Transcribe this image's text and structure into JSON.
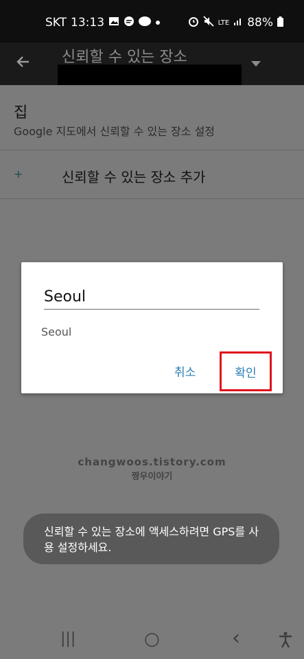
{
  "status_bar": {
    "carrier": "SKT",
    "time": "13:13",
    "network": "LTE",
    "battery": "88%",
    "icons": [
      "gallery-icon",
      "message-icon",
      "talk-icon",
      "dot-icon",
      "alarm-icon",
      "mute-icon",
      "signal-icon",
      "battery-icon"
    ]
  },
  "toolbar": {
    "back_icon": "back-arrow-icon",
    "title": "신뢰할 수 있는 장소",
    "dropdown_icon": "dropdown-triangle-icon"
  },
  "main": {
    "home_title": "집",
    "home_subtitle": "Google 지도에서 신뢰할 수 있는 장소 설정",
    "add_icon": "+",
    "add_label": "신뢰할 수 있는 장소 추가"
  },
  "dialog": {
    "input_value": "Seoul",
    "suggestion": "Seoul",
    "cancel_label": "취소",
    "ok_label": "확인",
    "highlight_color": "#e0101b"
  },
  "watermark": {
    "line1": "changwoos.tistory.com",
    "line2": "짱우이야기"
  },
  "toast": {
    "message": "신뢰할 수 있는 장소에 액세스하려면 GPS를 사용 설정하세요."
  },
  "nav": {
    "recents": "|||",
    "home": "○",
    "back": "‹",
    "accessibility": "accessibility-icon"
  },
  "colors": {
    "accent": "#2a7fb3",
    "scrim": "#7b7b7b",
    "status_bar": "#0f0f0f"
  }
}
